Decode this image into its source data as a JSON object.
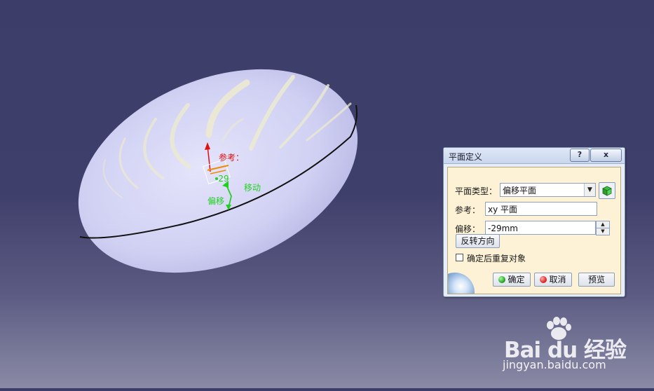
{
  "viewport": {
    "labels": {
      "reference": "参考：",
      "offset_value": "-29",
      "move": "移动",
      "offset": "偏移"
    }
  },
  "dialog": {
    "title": "平面定义",
    "help_label": "?",
    "close_label": "x",
    "plane_type_label": "平面类型：",
    "plane_type_value": "偏移平面",
    "reference_label": "参考：",
    "reference_value": "xy 平面",
    "offset_label": "偏移：",
    "offset_value": "-29mm",
    "reverse_button": "反转方向",
    "repeat_checkbox_label": "确定后重复对象",
    "repeat_checked": false,
    "ok_button": "确定",
    "cancel_button": "取消",
    "preview_button": "预览"
  },
  "watermark": {
    "main": "Bai du 经验",
    "sub": "jingyan.baidu.com"
  },
  "colors": {
    "background_top": "#3d3d69",
    "background_bottom": "#8a8aa6",
    "shape_fill": "#cfd0f2",
    "highlight": "#e8e6b8",
    "edge": "#111111",
    "annotation_red": "#e01010",
    "annotation_green": "#22d022",
    "annotation_orange": "#f08a00"
  }
}
